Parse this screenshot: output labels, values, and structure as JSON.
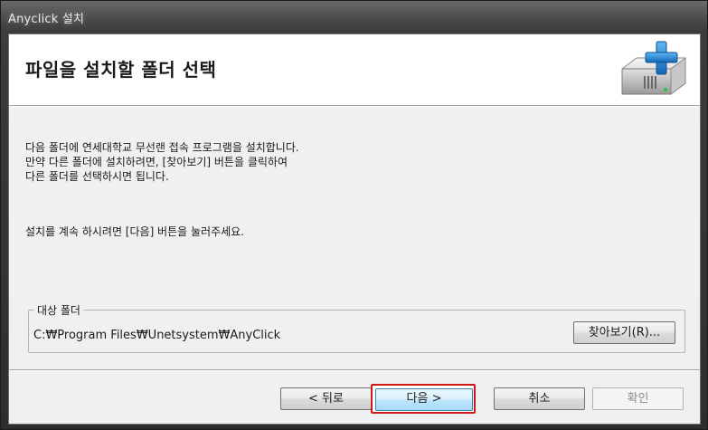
{
  "window": {
    "title": "Anyclick 설치"
  },
  "header": {
    "title": "파일을 설치할 폴더 선택",
    "icon": "hard-drive-plus-icon"
  },
  "body": {
    "desc_lines": [
      "다음 폴더에 연세대학교 무선랜 접속 프로그램을 설치합니다.",
      "만약 다른 폴더에 설치하려면, [찾아보기] 버튼을 클릭하여",
      "다른 폴더를 선택하시면 됩니다."
    ],
    "continue_text": "설치를 계속 하시려면 [다음] 버튼을 눌러주세요."
  },
  "destination": {
    "group_label": "대상 폴더",
    "path": "C:₩Program Files₩Unetsystem₩AnyClick",
    "browse_label": "찾아보기(R)..."
  },
  "buttons": {
    "back_label": "< 뒤로",
    "next_label": "다음 >",
    "cancel_label": "취소",
    "ok_label": "확인"
  },
  "colors": {
    "highlight": "#d01818",
    "accent_plus": "#1e88d6"
  }
}
